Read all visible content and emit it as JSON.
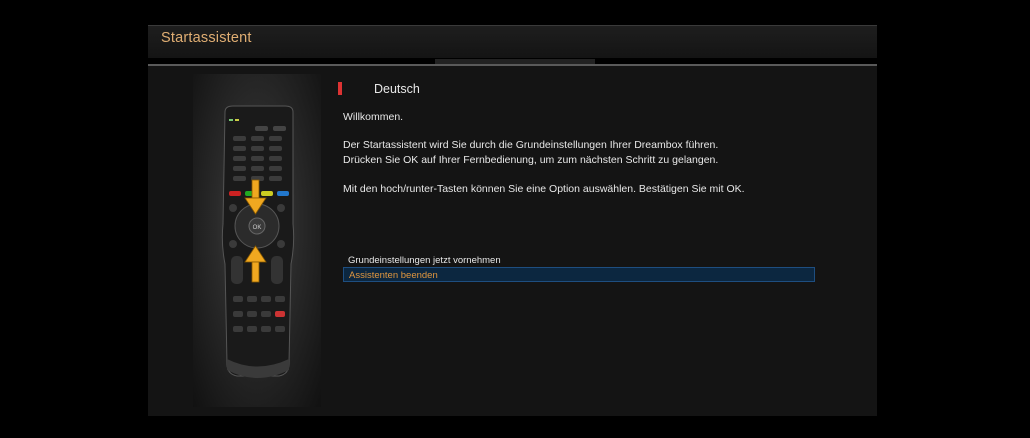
{
  "window": {
    "title": "Startassistent"
  },
  "language": {
    "label": "Deutsch"
  },
  "content": {
    "welcome": "Willkommen.",
    "line1": "Der Startassistent wird Sie durch die Grundeinstellungen Ihrer Dreambox führen.",
    "line2": "Drücken Sie OK auf Ihrer Fernbedienung, um zum nächsten Schritt zu gelangen.",
    "line3": "Mit den hoch/runter-Tasten können Sie eine Option auswählen. Bestätigen Sie mit OK."
  },
  "options": [
    {
      "label": "Grundeinstellungen jetzt vornehmen",
      "selected": false
    },
    {
      "label": "Assistenten beenden",
      "selected": true
    }
  ],
  "remote": {
    "ok_label": "OK"
  },
  "colors": {
    "accent_title": "#e0ae73",
    "selection_text": "#e0963e",
    "selection_bg": "#0c2740",
    "marker": "#dd3333",
    "arrow": "#f0a820"
  }
}
